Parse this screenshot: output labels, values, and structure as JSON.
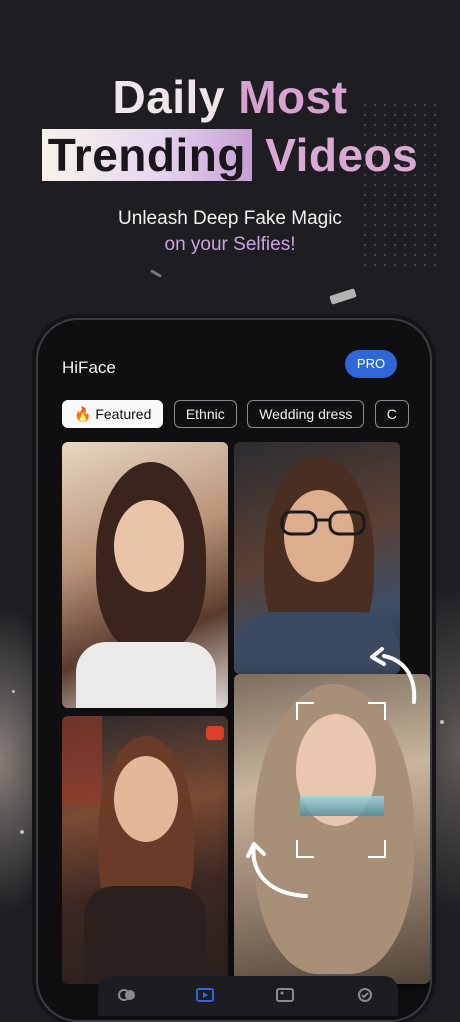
{
  "hero": {
    "line1_a": "Daily",
    "line1_b": "Most",
    "line2_highlight": "Trending",
    "line2_rest": "Videos",
    "subtitle_line1": "Unleash Deep Fake Magic",
    "subtitle_line2": "on your Selfies!"
  },
  "app": {
    "title": "HiFace",
    "pro_label": "PRO",
    "categories": [
      {
        "label": "🔥 Featured",
        "active": true
      },
      {
        "label": "Ethnic",
        "active": false
      },
      {
        "label": "Wedding dress",
        "active": false
      },
      {
        "label": "C",
        "active": false
      }
    ],
    "nav_icons": [
      "face-swap-icon",
      "video-icon",
      "photo-icon",
      "check-icon"
    ],
    "active_nav": "video-icon"
  },
  "colors": {
    "background": "#1d1d22",
    "accent_pink": "#d7a2cf",
    "pro_blue": "#2f68d6",
    "nav_active": "#2f68d6"
  }
}
